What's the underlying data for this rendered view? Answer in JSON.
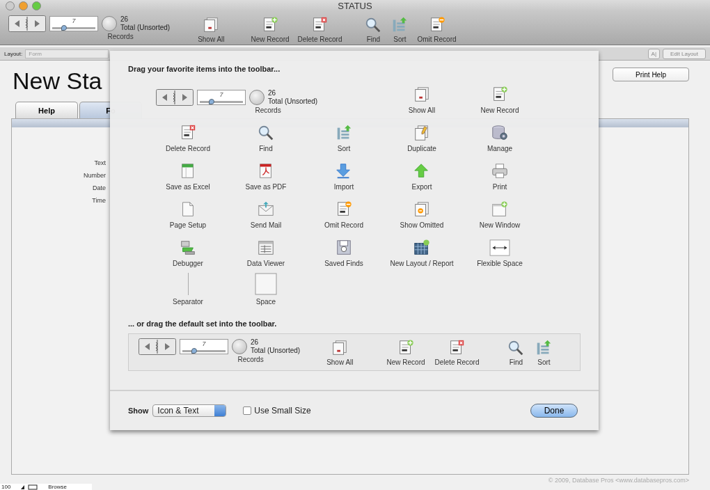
{
  "window": {
    "title": "STATUS"
  },
  "toolbar": {
    "records": {
      "value": "7",
      "level": 0.27,
      "found": "26",
      "total": "Total (Unsorted)",
      "label": "Records"
    },
    "items": [
      {
        "kind": "show-all",
        "label": "Show All"
      },
      {
        "kind": "new-record",
        "label": "New Record"
      },
      {
        "kind": "delete-record",
        "label": "Delete Record"
      },
      {
        "kind": "find",
        "label": "Find"
      },
      {
        "kind": "sort",
        "label": "Sort"
      },
      {
        "kind": "omit",
        "label": "Omit Record"
      }
    ]
  },
  "layout_bar": {
    "label": "Layout:",
    "layout": "Form",
    "font_button": "A|",
    "edit_button": "Edit Layout"
  },
  "page": {
    "title": "New Sta",
    "print_button": "Print Help",
    "tabs": [
      {
        "label": "Help",
        "selected": false
      },
      {
        "label": "Fo",
        "selected": true
      }
    ],
    "fields": [
      "Text",
      "Number",
      "Date",
      "Time"
    ],
    "footer": "© 2009, Database Pros <www.databasepros.com>"
  },
  "status_bar": {
    "zoom": "100",
    "mode": "Browse"
  },
  "sheet": {
    "heading": "Drag your favorite items into the toolbar...",
    "items": [
      {
        "kind": "records",
        "value": "7",
        "level": 0.27,
        "found": "26",
        "total": "Total (Unsorted)",
        "label": "Records"
      },
      {
        "kind": "show-all",
        "label": "Show All"
      },
      {
        "kind": "new-record",
        "label": "New Record"
      },
      {
        "kind": "delete-record",
        "label": "Delete Record"
      },
      {
        "kind": "find",
        "label": "Find"
      },
      {
        "kind": "sort",
        "label": "Sort"
      },
      {
        "kind": "duplicate",
        "label": "Duplicate"
      },
      {
        "kind": "manage",
        "label": "Manage"
      },
      {
        "kind": "excel",
        "label": "Save as Excel"
      },
      {
        "kind": "pdf",
        "label": "Save as PDF"
      },
      {
        "kind": "import",
        "label": "Import"
      },
      {
        "kind": "export",
        "label": "Export"
      },
      {
        "kind": "print",
        "label": "Print"
      },
      {
        "kind": "page-setup",
        "label": "Page Setup"
      },
      {
        "kind": "mail",
        "label": "Send Mail"
      },
      {
        "kind": "omit",
        "label": "Omit Record"
      },
      {
        "kind": "show-omitted",
        "label": "Show Omitted"
      },
      {
        "kind": "new-window",
        "label": "New Window"
      },
      {
        "kind": "debugger",
        "label": "Debugger"
      },
      {
        "kind": "data-viewer",
        "label": "Data Viewer"
      },
      {
        "kind": "saved-finds",
        "label": "Saved Finds"
      },
      {
        "kind": "new-layout",
        "label": "New Layout / Report"
      },
      {
        "kind": "flexible-space",
        "label": "Flexible Space"
      },
      {
        "kind": "separator",
        "label": "Separator"
      },
      {
        "kind": "space",
        "label": "Space"
      }
    ],
    "default_heading": "... or drag the default set into the toolbar.",
    "default_set": {
      "records": {
        "value": "7",
        "level": 0.27,
        "found": "26",
        "total": "Total (Unsorted)",
        "label": "Records"
      },
      "items": [
        {
          "kind": "show-all",
          "label": "Show All"
        },
        {
          "kind": "new-record",
          "label": "New Record"
        },
        {
          "kind": "delete-record",
          "label": "Delete Record"
        },
        {
          "kind": "find",
          "label": "Find"
        },
        {
          "kind": "sort",
          "label": "Sort"
        }
      ]
    },
    "show_label": "Show",
    "show_value": "Icon & Text",
    "small_size": {
      "label": "Use Small Size",
      "checked": false
    },
    "done": "Done"
  }
}
